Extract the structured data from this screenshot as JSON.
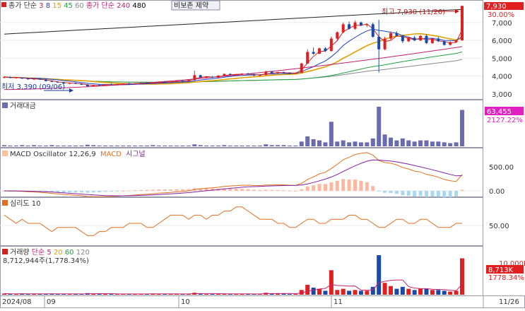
{
  "price_panel": {
    "legend": [
      {
        "text": "종가 단순",
        "color": "#333333"
      },
      {
        "text": "3",
        "color": "#d02020"
      },
      {
        "text": "8",
        "color": "#2040c0"
      },
      {
        "text": "15",
        "color": "#e0a000"
      },
      {
        "text": "45",
        "color": "#20a040"
      },
      {
        "text": "60",
        "color": "#888888"
      },
      {
        "text": "종가 단순 240",
        "color": "#c02070"
      },
      {
        "text": "480",
        "color": "#000000"
      }
    ],
    "toggle_label": "비보존 제약",
    "max_label": "최고 7,930 (11/26)",
    "min_label": "최저 3,390 (09/06)",
    "last_price_badge": "7,930",
    "last_change_badge": "30.00%",
    "y_ticks": [
      "7,000",
      "6,000",
      "5,000",
      "4,000",
      "3,000"
    ]
  },
  "amount_panel": {
    "title": "거래대금",
    "badge_value": "63,455",
    "badge_pct": "2127.22%"
  },
  "macd_panel": {
    "legend_main": "MACD Oscillator 12,26,9",
    "legend_macd": "MACD",
    "legend_signal": "시그널",
    "y_ticks": [
      "500.00",
      "0.00"
    ]
  },
  "psy_panel": {
    "title": "심리도 10",
    "y_ticks": [
      "50.00"
    ]
  },
  "volume_panel": {
    "legend": [
      {
        "text": "거래량",
        "color": "#333333"
      },
      {
        "text": "단순 5",
        "color": "#c02070"
      },
      {
        "text": "20",
        "color": "#e0a000"
      },
      {
        "text": "60",
        "color": "#20a040"
      },
      {
        "text": "120",
        "color": "#888888"
      }
    ],
    "last_volume_label": "8,712,944주(1,778.34%)",
    "badge_value": "8,713K",
    "badge_pct": "1778.34%",
    "y_ticks": [
      "10,000K"
    ]
  },
  "x_axis": {
    "labels": [
      "2024/08",
      "09",
      "10",
      "11",
      "11/26"
    ]
  },
  "chart_data": {
    "type": "candlestick",
    "series_name": "비보존 제약",
    "ylim": [
      2800,
      8100
    ],
    "candles": [
      [
        3920,
        3990,
        3880,
        3950
      ],
      [
        3950,
        3980,
        3880,
        3900
      ],
      [
        3900,
        3940,
        3860,
        3920
      ],
      [
        3920,
        3930,
        3840,
        3860
      ],
      [
        3860,
        3900,
        3800,
        3820
      ],
      [
        3820,
        3870,
        3780,
        3850
      ],
      [
        3850,
        3880,
        3790,
        3800
      ],
      [
        3800,
        3830,
        3700,
        3720
      ],
      [
        3720,
        3760,
        3660,
        3680
      ],
      [
        3680,
        3710,
        3620,
        3650
      ],
      [
        3650,
        3680,
        3560,
        3580
      ],
      [
        3580,
        3640,
        3540,
        3620
      ],
      [
        3620,
        3650,
        3550,
        3570
      ],
      [
        3570,
        3600,
        3500,
        3520
      ],
      [
        3520,
        3560,
        3390,
        3430
      ],
      [
        3430,
        3520,
        3410,
        3500
      ],
      [
        3500,
        3540,
        3460,
        3480
      ],
      [
        3480,
        3560,
        3470,
        3540
      ],
      [
        3540,
        3580,
        3500,
        3520
      ],
      [
        3520,
        3560,
        3480,
        3550
      ],
      [
        3550,
        3600,
        3520,
        3580
      ],
      [
        3580,
        3620,
        3540,
        3560
      ],
      [
        3560,
        3600,
        3520,
        3590
      ],
      [
        3590,
        3640,
        3560,
        3620
      ],
      [
        3620,
        3660,
        3580,
        3600
      ],
      [
        3600,
        3650,
        3580,
        3640
      ],
      [
        3640,
        3700,
        3620,
        3680
      ],
      [
        3680,
        3720,
        3640,
        3660
      ],
      [
        3660,
        3700,
        3640,
        3690
      ],
      [
        3690,
        3760,
        3670,
        3740
      ],
      [
        3740,
        3780,
        3700,
        3720
      ],
      [
        3720,
        3800,
        3700,
        3780
      ],
      [
        3780,
        4300,
        3760,
        4050
      ],
      [
        4050,
        4080,
        3900,
        3930
      ],
      [
        3930,
        3980,
        3880,
        3960
      ],
      [
        3960,
        4000,
        3900,
        3920
      ],
      [
        3920,
        4050,
        3910,
        4030
      ],
      [
        4030,
        4150,
        4000,
        4120
      ],
      [
        4120,
        4160,
        4050,
        4080
      ],
      [
        4080,
        4120,
        4020,
        4100
      ],
      [
        4100,
        4160,
        4060,
        4140
      ],
      [
        4140,
        4180,
        4080,
        4100
      ],
      [
        4100,
        4130,
        4000,
        4030
      ],
      [
        4030,
        4080,
        4000,
        4060
      ],
      [
        4060,
        4300,
        4050,
        4250
      ],
      [
        4250,
        4280,
        4150,
        4170
      ],
      [
        4170,
        4240,
        4140,
        4220
      ],
      [
        4220,
        4250,
        4150,
        4180
      ],
      [
        4180,
        4220,
        4100,
        4140
      ],
      [
        4140,
        4200,
        4120,
        4180
      ],
      [
        4180,
        4750,
        4170,
        4700
      ],
      [
        4700,
        5500,
        4680,
        5350
      ],
      [
        5350,
        5600,
        5200,
        5250
      ],
      [
        5250,
        5600,
        5230,
        5550
      ],
      [
        5550,
        5620,
        5350,
        5400
      ],
      [
        5400,
        6200,
        5380,
        6100
      ],
      [
        6100,
        6500,
        6000,
        6450
      ],
      [
        6450,
        7000,
        6400,
        6900
      ],
      [
        6900,
        7050,
        6600,
        6650
      ],
      [
        6650,
        7100,
        6600,
        7000
      ],
      [
        7000,
        7050,
        6800,
        6850
      ],
      [
        6850,
        6950,
        6750,
        6900
      ],
      [
        6900,
        7000,
        6150,
        6200
      ],
      [
        6200,
        7150,
        4200,
        5500
      ],
      [
        5500,
        6200,
        5450,
        6100
      ],
      [
        6100,
        6500,
        6000,
        6400
      ],
      [
        6400,
        6500,
        6200,
        6250
      ],
      [
        6250,
        6300,
        5850,
        5950
      ],
      [
        5950,
        6200,
        5900,
        6150
      ],
      [
        6150,
        6250,
        5950,
        6000
      ],
      [
        6000,
        6300,
        5950,
        6250
      ],
      [
        6250,
        6350,
        5800,
        5850
      ],
      [
        5850,
        6150,
        5800,
        6100
      ],
      [
        6100,
        6200,
        5900,
        5950
      ],
      [
        5950,
        6000,
        5700,
        5750
      ],
      [
        5750,
        5950,
        5700,
        5900
      ],
      [
        5900,
        6050,
        5850,
        6000
      ],
      [
        6000,
        7930,
        5980,
        7930
      ]
    ],
    "amount_pct_of_max": [
      0.03,
      0.02,
      0.02,
      0.03,
      0.02,
      0.03,
      0.02,
      0.02,
      0.03,
      0.02,
      0.02,
      0.02,
      0.02,
      0.02,
      0.04,
      0.03,
      0.02,
      0.02,
      0.02,
      0.02,
      0.02,
      0.02,
      0.02,
      0.02,
      0.02,
      0.03,
      0.02,
      0.02,
      0.02,
      0.02,
      0.02,
      0.02,
      0.05,
      0.03,
      0.02,
      0.02,
      0.02,
      0.03,
      0.02,
      0.02,
      0.02,
      0.02,
      0.02,
      0.02,
      0.05,
      0.03,
      0.03,
      0.03,
      0.02,
      0.02,
      0.12,
      0.25,
      0.18,
      0.15,
      0.1,
      0.62,
      0.12,
      0.15,
      0.1,
      0.12,
      0.1,
      0.1,
      0.2,
      1.0,
      0.3,
      0.22,
      0.15,
      0.2,
      0.15,
      0.12,
      0.15,
      0.15,
      0.12,
      0.12,
      0.1,
      0.08,
      0.1,
      0.92
    ],
    "psy_values": [
      70,
      60,
      50,
      60,
      50,
      50,
      50,
      40,
      30,
      40,
      40,
      40,
      40,
      30,
      20,
      20,
      30,
      30,
      40,
      40,
      40,
      50,
      50,
      50,
      40,
      40,
      50,
      60,
      70,
      70,
      70,
      60,
      70,
      70,
      60,
      70,
      70,
      80,
      80,
      90,
      90,
      80,
      70,
      60,
      60,
      60,
      50,
      50,
      40,
      40,
      50,
      60,
      60,
      50,
      50,
      60,
      60,
      60,
      70,
      70,
      60,
      60,
      50,
      40,
      40,
      50,
      60,
      60,
      50,
      50,
      60,
      60,
      50,
      40,
      40,
      40,
      50,
      50
    ]
  }
}
